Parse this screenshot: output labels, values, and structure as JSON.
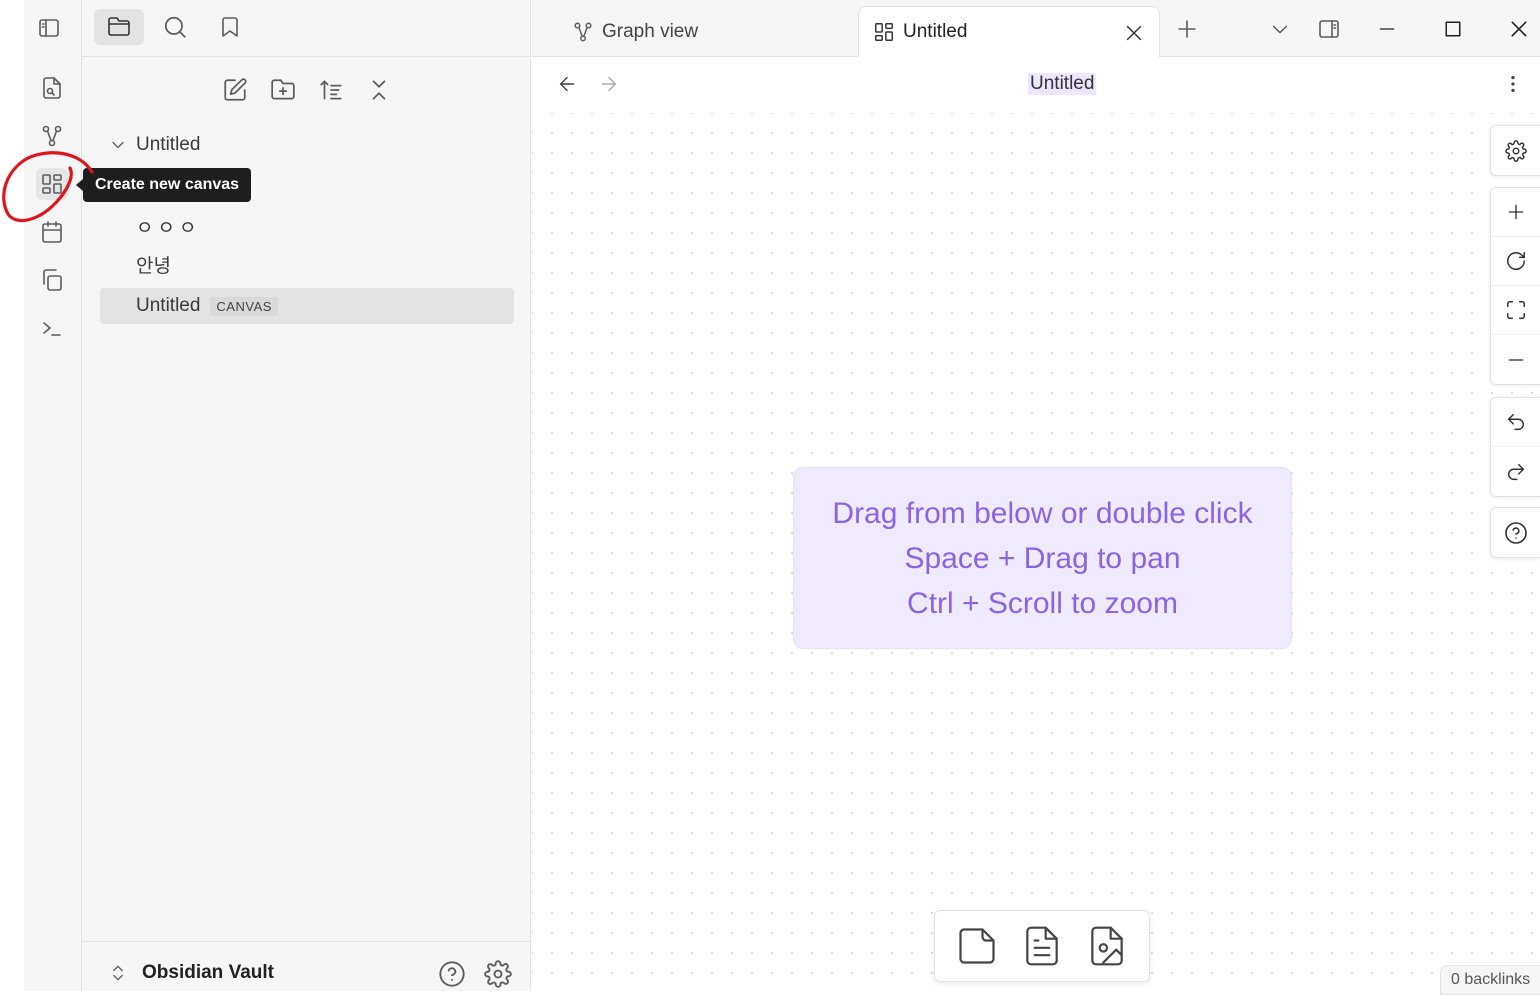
{
  "ribbon": {
    "items": [
      {
        "name": "quick-switcher",
        "icon": "file-search-icon"
      },
      {
        "name": "graph-view",
        "icon": "graph-icon"
      },
      {
        "name": "create-canvas",
        "icon": "canvas-icon"
      },
      {
        "name": "daily-notes",
        "icon": "calendar-icon"
      },
      {
        "name": "templates",
        "icon": "copy-icon"
      },
      {
        "name": "command-palette",
        "icon": "terminal-icon"
      }
    ]
  },
  "tooltip": {
    "text": "Create new canvas"
  },
  "sidebar": {
    "tabs": [
      "files-icon",
      "search-icon",
      "bookmark-icon"
    ],
    "actions": [
      "new-note-icon",
      "new-folder-icon",
      "sort-icon",
      "collapse-all-icon"
    ],
    "tree": {
      "folder": "Untitled",
      "files": [
        "ㅇㅇㅇ",
        "안녕"
      ],
      "active_file": {
        "name": "Untitled",
        "badge": "CANVAS"
      }
    },
    "vault": {
      "name": "Obsidian Vault"
    }
  },
  "tabs": [
    {
      "label": "Graph view",
      "icon": "graph-icon"
    },
    {
      "label": "Untitled",
      "icon": "canvas-icon",
      "active": true
    }
  ],
  "view": {
    "title": "Untitled"
  },
  "canvas": {
    "placeholder_lines": [
      "Drag from below or double click",
      "Space + Drag to pan",
      "Ctrl + Scroll to zoom"
    ]
  },
  "status": {
    "backlinks": "0 backlinks"
  },
  "colors": {
    "accent": "#8d63e6",
    "placeholder_bg": "#efeafd",
    "annotation": "#e0141c"
  }
}
